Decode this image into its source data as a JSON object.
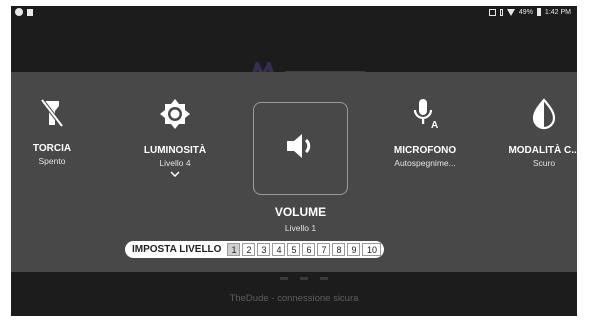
{
  "status_bar": {
    "battery": "49%",
    "time": "1:42 PM",
    "icons": [
      "notification-dot-icon",
      "photo-icon",
      "nfc-icon",
      "signal-icon",
      "wifi-icon",
      "battery-icon"
    ]
  },
  "background": {
    "footer_text": "TheDude - connessione sicura"
  },
  "tiles": [
    {
      "label": "TORCIA",
      "sub": "Spento",
      "icon": "flashlight-off-icon"
    },
    {
      "label": "LUMINOSITÀ",
      "sub": "Livello 4",
      "icon": "brightness-icon"
    },
    {
      "label": "VOLUME",
      "sub": "Livello 1",
      "icon": "volume-icon"
    },
    {
      "label": "MICROFONO",
      "sub": "Autospegnime...",
      "icon": "microphone-icon"
    },
    {
      "label": "MODALITÀ C...",
      "sub": "Scuro",
      "icon": "contrast-icon"
    }
  ],
  "level_selector": {
    "label": "IMPOSTA LIVELLO",
    "levels": [
      "1",
      "2",
      "3",
      "4",
      "5",
      "6",
      "7",
      "8",
      "9",
      "10"
    ],
    "selected": "1"
  },
  "colors": {
    "panel": "#484848",
    "screen": "#1c1c1c",
    "text": "#ffffff"
  }
}
